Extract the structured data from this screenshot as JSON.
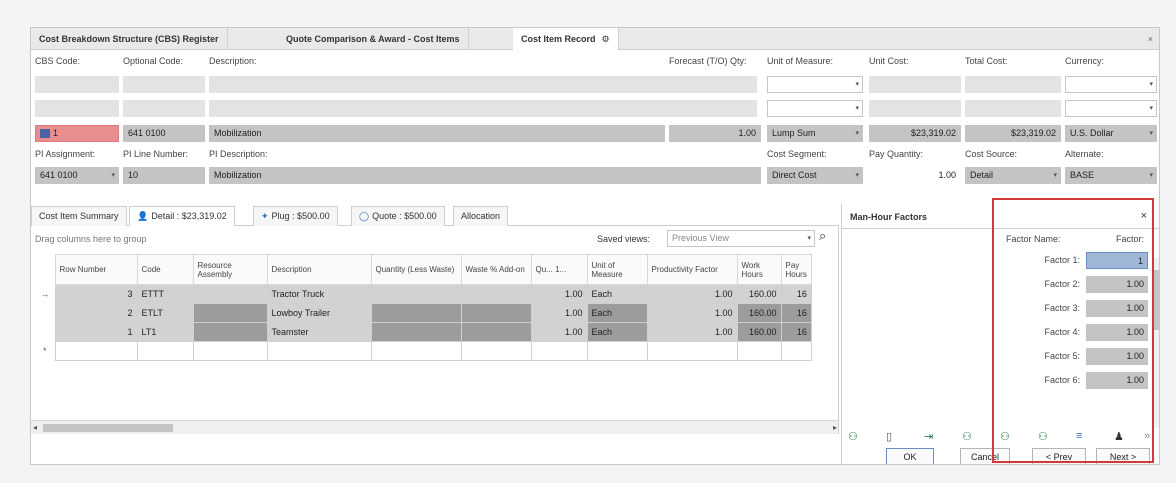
{
  "tabs": [
    {
      "label": "Cost Breakdown Structure (CBS) Register"
    },
    {
      "label": "Quote Comparison & Award - Cost Items"
    },
    {
      "label": "Cost Item Record"
    }
  ],
  "header_labels": {
    "cbs_code": "CBS Code:",
    "optional_code": "Optional Code:",
    "description": "Description:",
    "forecast_qty": "Forecast (T/O) Qty:",
    "uom": "Unit of Measure:",
    "unit_cost": "Unit Cost:",
    "total_cost": "Total Cost:",
    "currency": "Currency:",
    "pi_assignment": "PI Assignment:",
    "pi_line_number": "PI Line Number:",
    "pi_description": "PI Description:",
    "cost_segment": "Cost Segment:",
    "pay_quantity": "Pay Quantity:",
    "cost_source": "Cost Source:",
    "alternate": "Alternate:"
  },
  "record": {
    "cbs_code": "1",
    "optional_code": "641 0100",
    "description": "Mobilization",
    "forecast_qty": "1.00",
    "uom": "Lump Sum",
    "unit_cost": "$23,319.02",
    "total_cost": "$23,319.02",
    "currency": "U.S. Dollar",
    "pi_assignment": "641 0100",
    "pi_line_number": "10",
    "pi_description": "Mobilization",
    "cost_segment": "Direct Cost",
    "pay_quantity": "1.00",
    "cost_source": "Detail",
    "alternate": "BASE"
  },
  "sub_tabs": [
    {
      "label": "Cost Item Summary"
    },
    {
      "label": "Detail : $23,319.02"
    },
    {
      "label": "Plug : $500.00"
    },
    {
      "label": "Quote : $500.00"
    },
    {
      "label": "Allocation"
    }
  ],
  "grid": {
    "group_hint": "Drag columns here to group",
    "saved_views_label": "Saved views:",
    "saved_views_placeholder": "Previous View",
    "columns": [
      "Row Number",
      "Code",
      "Resource Assembly",
      "Description",
      "Quantity (Less Waste)",
      "Waste % Add-on",
      "Qu... 1...",
      "Unit of Measure",
      "Productivity Factor",
      "Work Hours",
      "Pay Hours"
    ],
    "rows": [
      {
        "indicator": "→",
        "row": "3",
        "code": "ETTT",
        "resource": "",
        "description": "Tractor Truck",
        "qty": "",
        "waste": "",
        "qu": "1.00",
        "uom": "Each",
        "prod": "1.00",
        "work": "160.00",
        "pay": "16"
      },
      {
        "indicator": "",
        "row": "2",
        "code": "ETLT",
        "resource": "",
        "description": "Lowboy Trailer",
        "qty": "",
        "waste": "",
        "qu": "1.00",
        "uom": "Each",
        "prod": "1.00",
        "work": "160.00",
        "pay": "16"
      },
      {
        "indicator": "",
        "row": "1",
        "code": "LT1",
        "resource": "",
        "description": "Teamster",
        "qty": "",
        "waste": "",
        "qu": "1.00",
        "uom": "Each",
        "prod": "1.00",
        "work": "160.00",
        "pay": "16"
      }
    ],
    "new_row_indicator": "*"
  },
  "man_hour": {
    "title": "Man-Hour Factors",
    "factor_name_header": "Factor Name:",
    "factor_header": "Factor:",
    "factors": [
      {
        "name": "Factor 1:",
        "value": "1"
      },
      {
        "name": "Factor 2:",
        "value": "1.00"
      },
      {
        "name": "Factor 3:",
        "value": "1.00"
      },
      {
        "name": "Factor 4:",
        "value": "1.00"
      },
      {
        "name": "Factor 5:",
        "value": "1.00"
      },
      {
        "name": "Factor 6:",
        "value": "1.00"
      }
    ]
  },
  "buttons": {
    "ok": "OK",
    "cancel": "Cancel",
    "prev": "< Prev",
    "next": "Next >"
  },
  "colors": {
    "highlight": "#d03a3a",
    "cbs_code_bg": "#e88e8e"
  }
}
